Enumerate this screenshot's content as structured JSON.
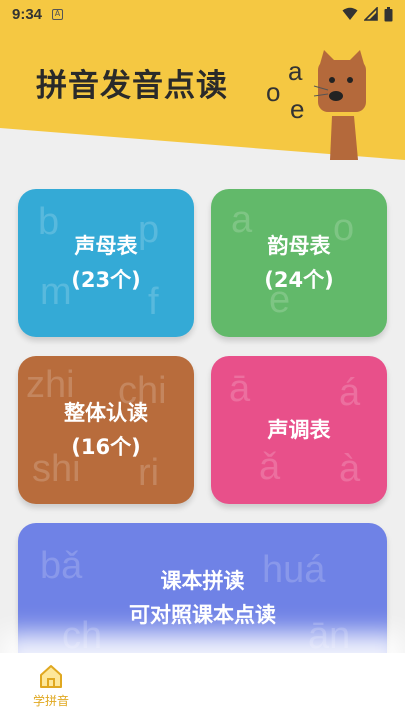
{
  "status_bar": {
    "time": "9:34",
    "app_icon": "A",
    "icons": [
      "wifi-icon",
      "signal-icon",
      "battery-icon"
    ]
  },
  "header": {
    "title": "拼音发音点读",
    "mascot_letters": [
      "o",
      "a",
      "e"
    ]
  },
  "cards": [
    {
      "title": "声母表",
      "subtitle": "(23个)",
      "color": "#34aad6",
      "bg_letters": [
        "b",
        "p",
        "m",
        "f"
      ]
    },
    {
      "title": "韵母表",
      "subtitle": "(24个)",
      "color": "#62b96a",
      "bg_letters": [
        "a",
        "o",
        "e"
      ]
    },
    {
      "title": "整体认读",
      "subtitle": "(16个)",
      "color": "#b86c3c",
      "bg_letters": [
        "zhi",
        "chi",
        "shi",
        "ri"
      ]
    },
    {
      "title": "声调表",
      "subtitle": "",
      "color": "#e8508a",
      "bg_letters": [
        "ā",
        "á",
        "ǎ",
        "à"
      ]
    },
    {
      "title": "课本拼读",
      "subtitle": "可对照课本点读",
      "color": "#6f82e6",
      "bg_letters": [
        "bǎ",
        "huá",
        "ch",
        "ān"
      ]
    }
  ],
  "bottom_nav": {
    "tabs": [
      {
        "label": "学拼音",
        "icon": "home-icon",
        "active": true
      }
    ]
  },
  "colors": {
    "header_bg": "#f5c842",
    "active_tab": "#e0a820"
  }
}
